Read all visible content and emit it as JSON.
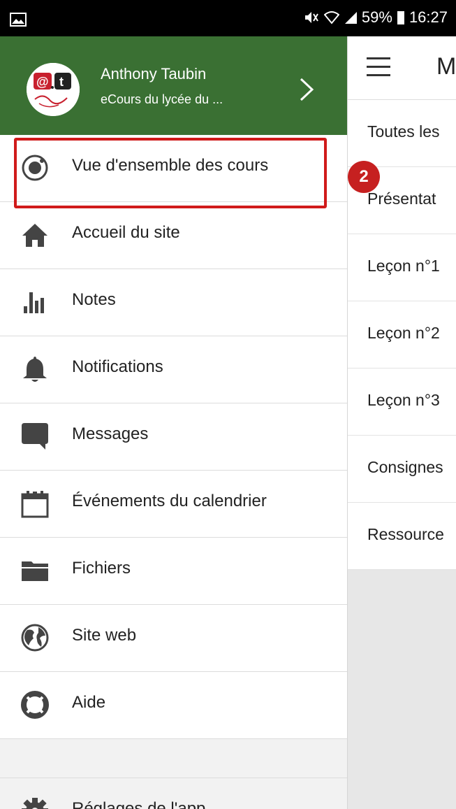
{
  "status_bar": {
    "battery": "59%",
    "time": "16:27"
  },
  "user": {
    "name": "Anthony Taubin",
    "site": "eCours du lycée du ..."
  },
  "menu": [
    {
      "label": "Vue d'ensemble des cours",
      "icon": "course-overview-icon"
    },
    {
      "label": "Accueil du site",
      "icon": "home-icon"
    },
    {
      "label": "Notes",
      "icon": "grades-icon"
    },
    {
      "label": "Notifications",
      "icon": "bell-icon"
    },
    {
      "label": "Messages",
      "icon": "chat-icon"
    },
    {
      "label": "Événements du calendrier",
      "icon": "calendar-icon"
    },
    {
      "label": "Fichiers",
      "icon": "folder-icon"
    },
    {
      "label": "Site web",
      "icon": "globe-icon"
    },
    {
      "label": "Aide",
      "icon": "lifebuoy-icon"
    }
  ],
  "settings": {
    "label": "Réglages de l'app",
    "icon": "gear-icon"
  },
  "content": {
    "title": "M",
    "rows": [
      "Toutes les",
      "Présentat",
      "Leçon n°1",
      "Leçon n°2",
      "Leçon n°3",
      "Consignes",
      "Ressource"
    ]
  },
  "annotation": {
    "badge": "2",
    "color": "#d01a1a"
  },
  "colors": {
    "header": "#3a7033",
    "annotation_red": "#c62020"
  }
}
